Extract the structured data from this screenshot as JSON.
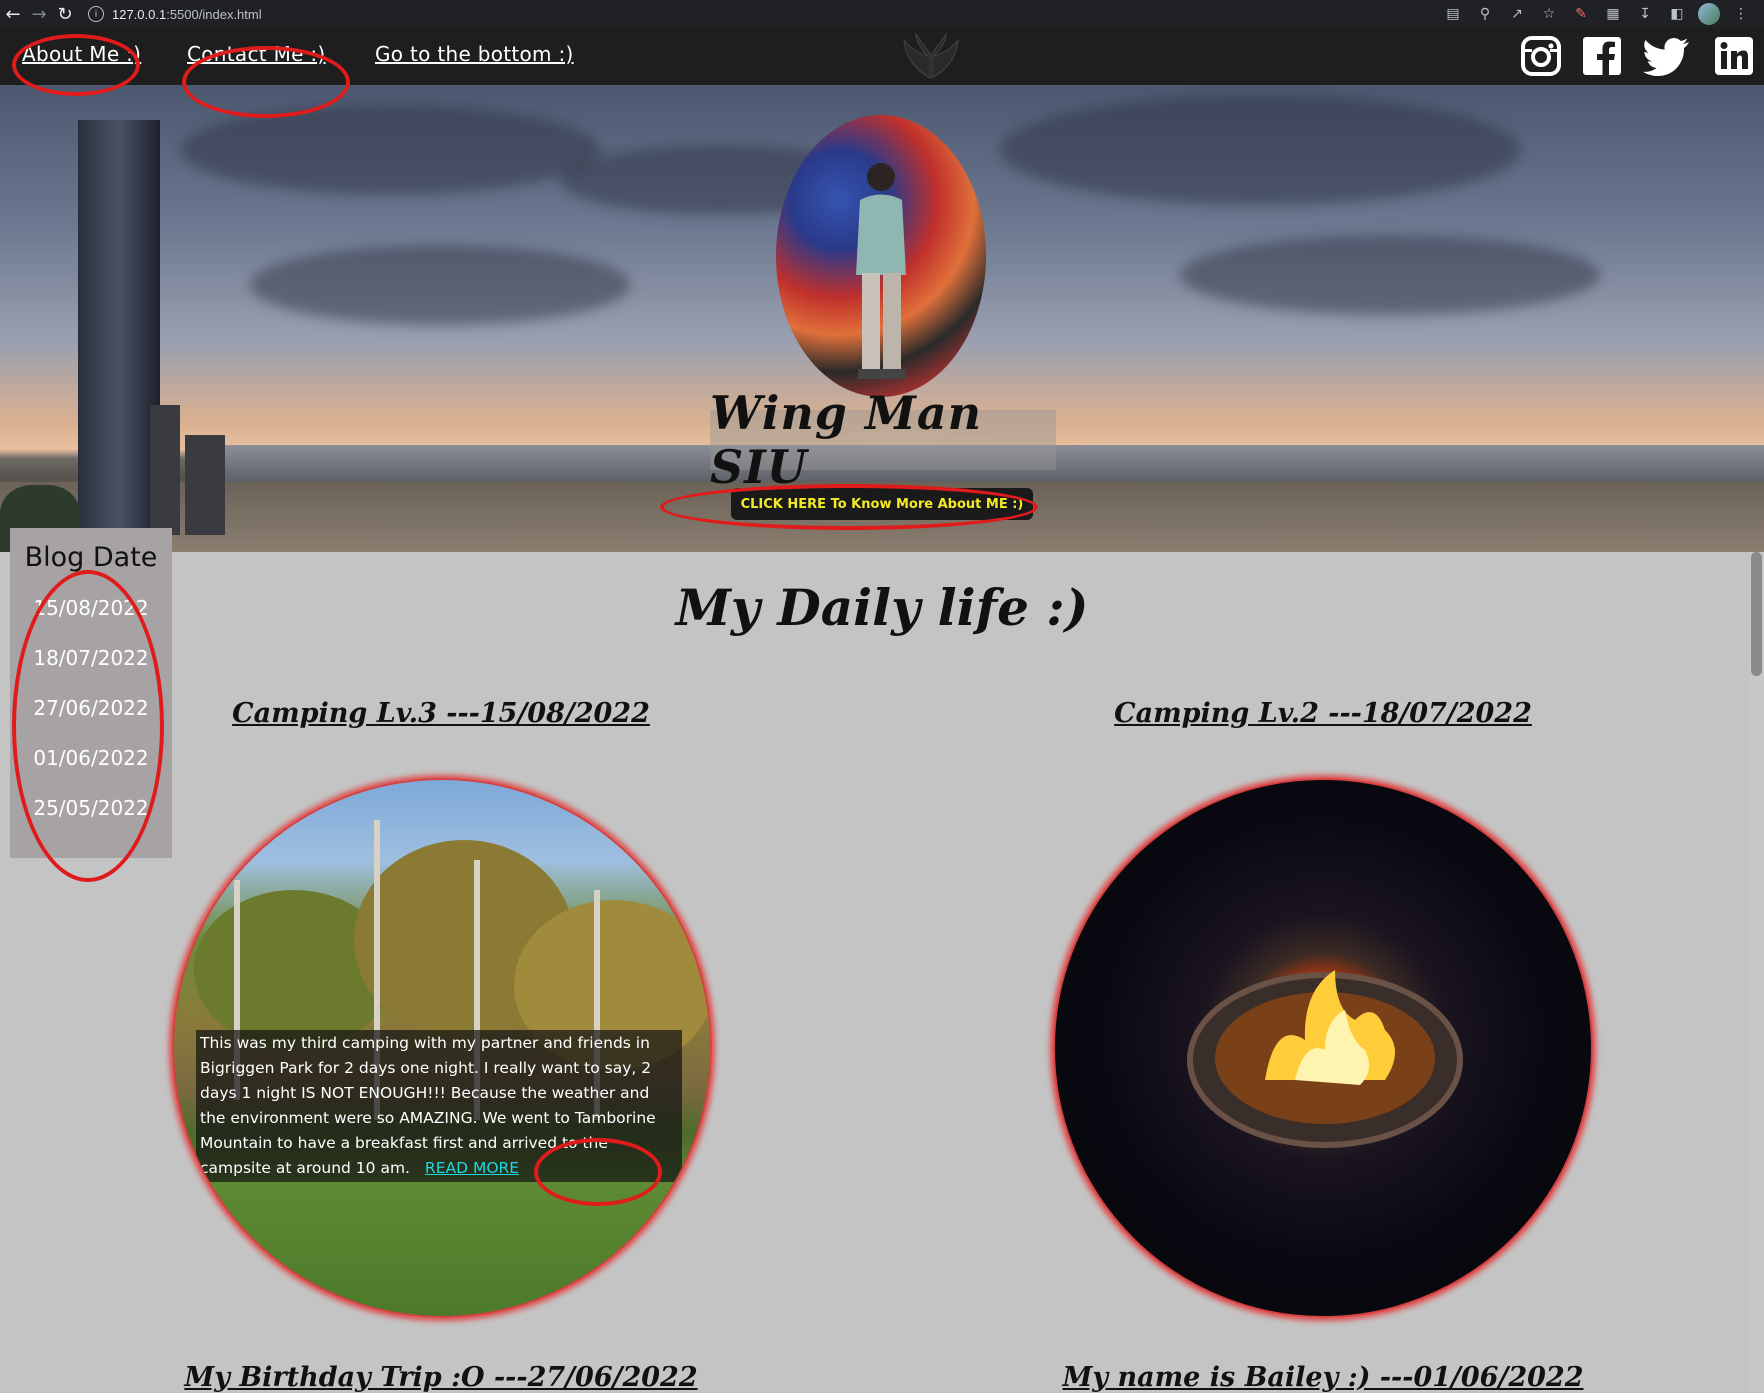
{
  "browser": {
    "url_host": "127.0.0.1",
    "url_rest": ":5500/index.html"
  },
  "nav": {
    "about": "About Me :)",
    "contact": "Contact Me :)",
    "bottom": "Go to the bottom :)"
  },
  "social": [
    "instagram-icon",
    "facebook-icon",
    "twitter-icon",
    "linkedin-icon"
  ],
  "hero": {
    "name": "Wing Man SIU",
    "button": "CLICK HERE To Know More About ME :)"
  },
  "sidebar": {
    "title": "Blog Date",
    "dates": [
      "15/08/2022",
      "18/07/2022",
      "27/06/2022",
      "01/06/2022",
      "25/05/2022"
    ]
  },
  "main": {
    "title": "My Daily life :)",
    "posts": [
      {
        "title": "Camping Lv.3 ---15/08/2022",
        "excerpt": "This was my third camping with my partner and friends in Bigriggen Park for 2 days one night. I really want to say, 2 days 1 night IS NOT ENOUGH!!! Because the weather and the environment were so AMAZING. We went to Tamborine Mountain to have a breakfast first and arrived to the campsite at around 10 am.",
        "read_more": "READ MORE"
      },
      {
        "title": "Camping Lv.2 ---18/07/2022"
      },
      {
        "title": "My Birthday Trip :O ---27/06/2022"
      },
      {
        "title": "My name is Bailey :) ---01/06/2022"
      }
    ]
  },
  "colors": {
    "nav_bg": "#1e1e1e",
    "page_bg": "#c4c4c4",
    "hero_button_text": "#f3ea27",
    "read_more": "#1fd7e0",
    "annotation": "#e01b1b"
  }
}
